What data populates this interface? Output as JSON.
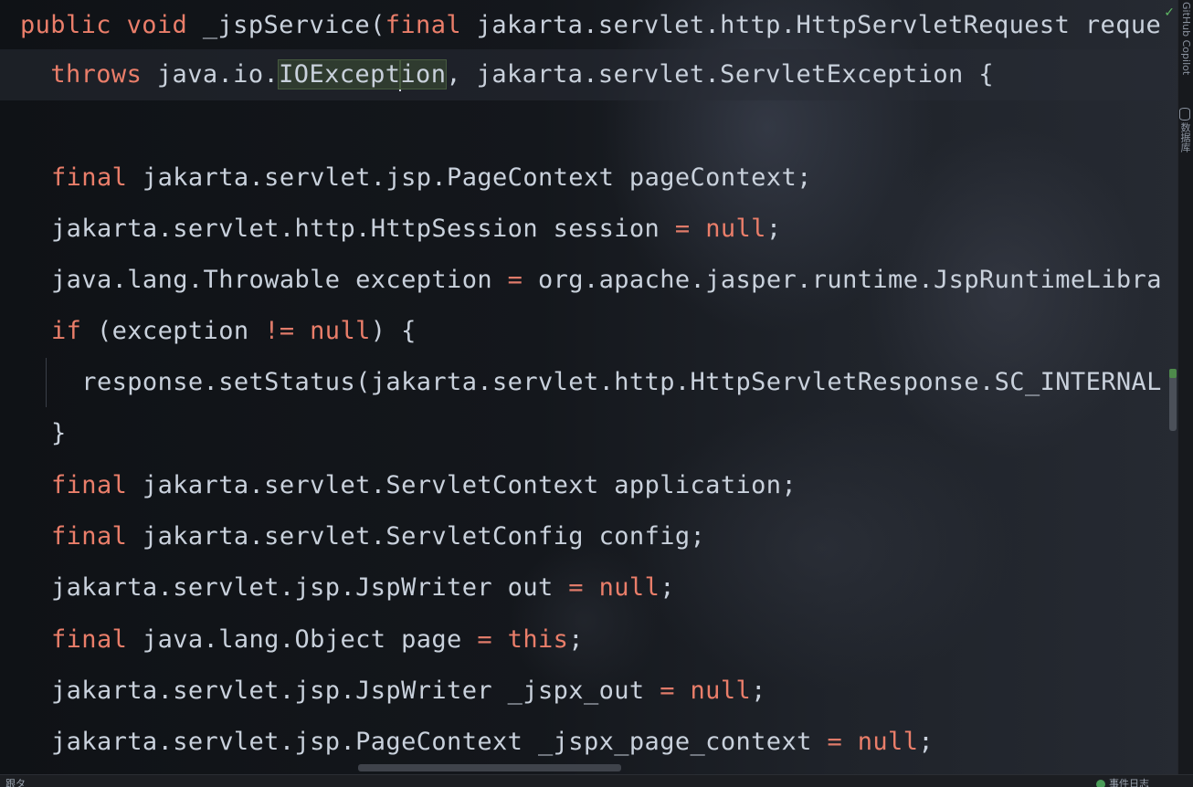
{
  "colors": {
    "keyword": "#ea7e6a",
    "text": "#c9d1dc",
    "background": "#111418",
    "highlight": "#2f3b2f",
    "status_ok": "#4a9c58"
  },
  "editor": {
    "lines": [
      {
        "id": "l1",
        "tokens": [
          {
            "t": "public",
            "k": "kw"
          },
          {
            "t": " ",
            "k": "tx"
          },
          {
            "t": "void",
            "k": "kw"
          },
          {
            "t": " _jspService(",
            "k": "tx"
          },
          {
            "t": "final",
            "k": "kw"
          },
          {
            "t": " jakarta.servlet.http.HttpServletRequest reque",
            "k": "tx"
          }
        ]
      },
      {
        "id": "l2",
        "tokens": [
          {
            "t": "  ",
            "k": "tx"
          },
          {
            "t": "throws",
            "k": "kw"
          },
          {
            "t": " java.io.",
            "k": "tx"
          },
          {
            "t": "IOExcept",
            "k": "hl"
          },
          {
            "t": "|caret|",
            "k": "caret"
          },
          {
            "t": "ion",
            "k": "hl"
          },
          {
            "t": ", jakarta.servlet.ServletException {",
            "k": "tx"
          }
        ]
      },
      {
        "id": "l3",
        "tokens": []
      },
      {
        "id": "l4",
        "tokens": [
          {
            "t": "final",
            "k": "kw"
          },
          {
            "t": " jakarta.servlet.jsp.PageContext pageContext;",
            "k": "tx"
          }
        ]
      },
      {
        "id": "l5",
        "tokens": [
          {
            "t": "jakarta.servlet.http.HttpSession session ",
            "k": "tx"
          },
          {
            "t": "=",
            "k": "op"
          },
          {
            "t": " ",
            "k": "tx"
          },
          {
            "t": "null",
            "k": "kw"
          },
          {
            "t": ";",
            "k": "tx"
          }
        ]
      },
      {
        "id": "l6",
        "tokens": [
          {
            "t": "java.lang.Throwable exception ",
            "k": "tx"
          },
          {
            "t": "=",
            "k": "op"
          },
          {
            "t": " org.apache.jasper.runtime.JspRuntimeLibra",
            "k": "tx"
          }
        ]
      },
      {
        "id": "l7",
        "tokens": [
          {
            "t": "if",
            "k": "kw"
          },
          {
            "t": " (exception ",
            "k": "tx"
          },
          {
            "t": "!=",
            "k": "op"
          },
          {
            "t": " ",
            "k": "tx"
          },
          {
            "t": "null",
            "k": "kw"
          },
          {
            "t": ") {",
            "k": "tx"
          }
        ]
      },
      {
        "id": "l8",
        "tokens": [
          {
            "t": "  response.setStatus(jakarta.servlet.http.HttpServletResponse.SC_INTERNAL",
            "k": "tx"
          }
        ]
      },
      {
        "id": "l9",
        "tokens": [
          {
            "t": "}",
            "k": "tx"
          }
        ]
      },
      {
        "id": "l10",
        "tokens": [
          {
            "t": "final",
            "k": "kw"
          },
          {
            "t": " jakarta.servlet.ServletContext application;",
            "k": "tx"
          }
        ]
      },
      {
        "id": "l11",
        "tokens": [
          {
            "t": "final",
            "k": "kw"
          },
          {
            "t": " jakarta.servlet.ServletConfig config;",
            "k": "tx"
          }
        ]
      },
      {
        "id": "l12",
        "tokens": [
          {
            "t": "jakarta.servlet.jsp.JspWriter out ",
            "k": "tx"
          },
          {
            "t": "=",
            "k": "op"
          },
          {
            "t": " ",
            "k": "tx"
          },
          {
            "t": "null",
            "k": "kw"
          },
          {
            "t": ";",
            "k": "tx"
          }
        ]
      },
      {
        "id": "l13",
        "tokens": [
          {
            "t": "final",
            "k": "kw"
          },
          {
            "t": " java.lang.Object page ",
            "k": "tx"
          },
          {
            "t": "=",
            "k": "op"
          },
          {
            "t": " ",
            "k": "tx"
          },
          {
            "t": "this",
            "k": "kw"
          },
          {
            "t": ";",
            "k": "tx"
          }
        ]
      },
      {
        "id": "l14",
        "tokens": [
          {
            "t": "jakarta.servlet.jsp.JspWriter _jspx_out ",
            "k": "tx"
          },
          {
            "t": "=",
            "k": "op"
          },
          {
            "t": " ",
            "k": "tx"
          },
          {
            "t": "null",
            "k": "kw"
          },
          {
            "t": ";",
            "k": "tx"
          }
        ]
      },
      {
        "id": "l15",
        "tokens": [
          {
            "t": "jakarta.servlet.jsp.PageContext _jspx_page_context ",
            "k": "tx"
          },
          {
            "t": "=",
            "k": "op"
          },
          {
            "t": " ",
            "k": "tx"
          },
          {
            "t": "null",
            "k": "kw"
          },
          {
            "t": ";",
            "k": "tx"
          }
        ]
      }
    ]
  },
  "right_panel": {
    "copilot_label": "GitHub Copilot",
    "database_label": "数据库",
    "check_icon": "check-icon",
    "database_icon": "database-icon"
  },
  "statusbar": {
    "left_text": "跟タ",
    "right_text": "事件日志"
  }
}
